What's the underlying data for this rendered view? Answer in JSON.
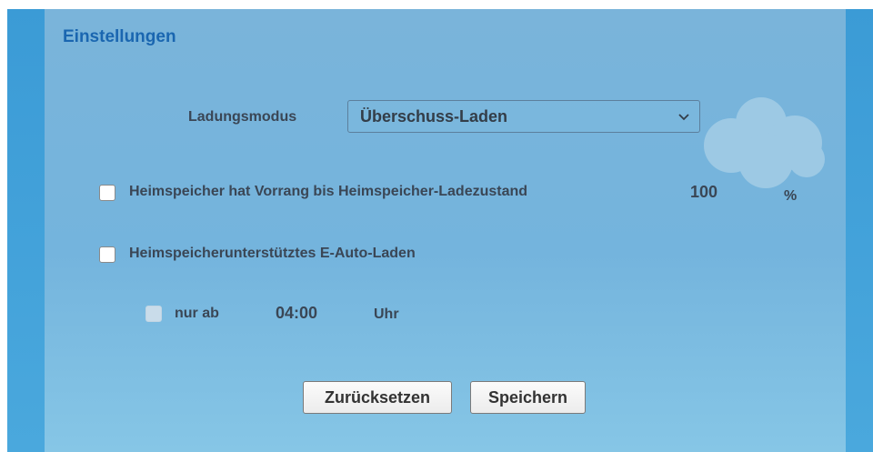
{
  "panel": {
    "title": "Einstellungen"
  },
  "charging_mode": {
    "label": "Ladungsmodus",
    "selected": "Überschuss-Laden"
  },
  "priority": {
    "checked": false,
    "label": "Heimspeicher hat Vorrang bis Heimspeicher-Ladezustand",
    "value": "100",
    "unit": "%"
  },
  "supported_charging": {
    "checked": false,
    "label": "Heimspeicherunterstütztes E-Auto-Laden"
  },
  "only_from": {
    "checked": false,
    "disabled": true,
    "label": "nur ab",
    "time": "04:00",
    "unit": "Uhr"
  },
  "buttons": {
    "reset": "Zurücksetzen",
    "save": "Speichern"
  },
  "icons": {
    "cloud": "cloud-icon",
    "chevron": "chevron-down-icon"
  },
  "colors": {
    "title": "#1a66b0",
    "panel": "#78b6dc",
    "border": "#3b9bd6"
  }
}
